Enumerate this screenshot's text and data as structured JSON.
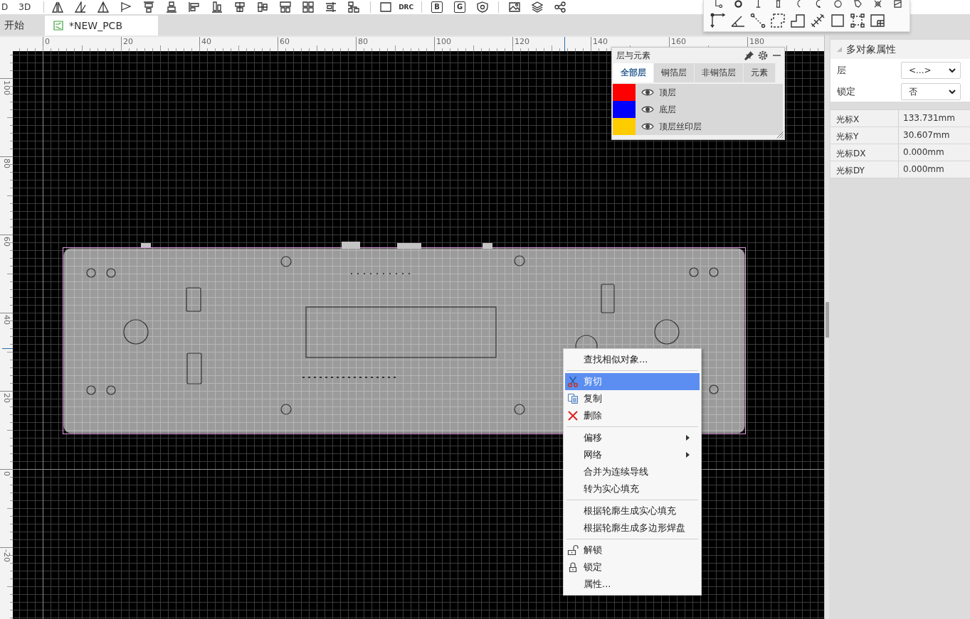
{
  "toolbar": {
    "labels": [
      "D",
      "3D",
      "DRC",
      "B",
      "G"
    ]
  },
  "tabs": [
    {
      "label": "开始",
      "kind": "start",
      "selected": false
    },
    {
      "label": "*NEW_PCB",
      "kind": "pcb",
      "selected": true
    }
  ],
  "rulers": {
    "horizontal": [
      "0",
      "20",
      "40",
      "60",
      "80",
      "100",
      "120",
      "140",
      "160",
      "180"
    ],
    "vertical": [
      "100",
      "80",
      "60",
      "40",
      "20",
      "0",
      "-20"
    ]
  },
  "layers_panel": {
    "title": "层与元素",
    "tabs": [
      {
        "label": "全部层",
        "selected": true
      },
      {
        "label": "铜箔层",
        "selected": false
      },
      {
        "label": "非铜箔层",
        "selected": false
      },
      {
        "label": "元素",
        "selected": false
      }
    ],
    "layers": [
      {
        "name": "顶层",
        "color": "#ff0000",
        "visible": true
      },
      {
        "name": "底层",
        "color": "#0000ff",
        "visible": true
      },
      {
        "name": "顶层丝印层",
        "color": "#ffcc00",
        "visible": true
      }
    ]
  },
  "context_menu": {
    "sections": [
      [
        {
          "label": "查找相似对象...",
          "kind": "plain",
          "submenu": false,
          "selected": false
        }
      ],
      [
        {
          "label": "剪切",
          "kind": "cut",
          "submenu": false,
          "selected": true
        },
        {
          "label": "复制",
          "kind": "copy",
          "submenu": false,
          "selected": false
        },
        {
          "label": "删除",
          "kind": "delete",
          "submenu": false,
          "selected": false
        }
      ],
      [
        {
          "label": "偏移",
          "kind": "plain",
          "submenu": true,
          "selected": false
        },
        {
          "label": "网络",
          "kind": "plain",
          "submenu": true,
          "selected": false
        },
        {
          "label": "合并为连续导线",
          "kind": "plain",
          "submenu": false,
          "selected": false
        },
        {
          "label": "转为实心填充",
          "kind": "plain",
          "submenu": false,
          "selected": false
        }
      ],
      [
        {
          "label": "根据轮廓生成实心填充",
          "kind": "plain",
          "submenu": false,
          "selected": false
        },
        {
          "label": "根据轮廓生成多边形焊盘",
          "kind": "plain",
          "submenu": false,
          "selected": false
        }
      ],
      [
        {
          "label": "解锁",
          "kind": "unlock",
          "submenu": false,
          "selected": false
        },
        {
          "label": "锁定",
          "kind": "lock",
          "submenu": false,
          "selected": false
        },
        {
          "label": "属性...",
          "kind": "plain",
          "submenu": false,
          "selected": false
        }
      ]
    ]
  },
  "properties": {
    "title": "多对象属性",
    "expanded": true,
    "fields": [
      {
        "label": "层",
        "value": "<...>"
      },
      {
        "label": "锁定",
        "value": "否"
      }
    ],
    "readouts": [
      {
        "label": "光标X",
        "value": "133.731mm"
      },
      {
        "label": "光标Y",
        "value": "30.607mm"
      },
      {
        "label": "光标DX",
        "value": "0.000mm"
      },
      {
        "label": "光标DY",
        "value": "0.000mm"
      }
    ]
  }
}
